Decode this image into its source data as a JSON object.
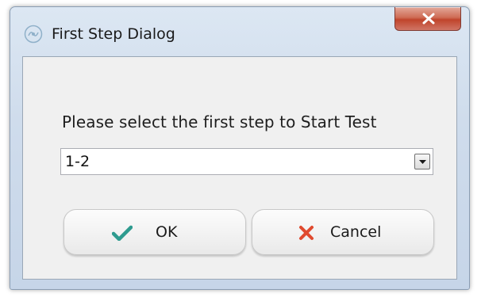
{
  "window": {
    "title": "First Step Dialog",
    "app_icon": "app-logo-icon",
    "close_icon": "close-icon"
  },
  "dialog": {
    "prompt": "Please select the first step to Start Test",
    "step_select": {
      "value": "1-2",
      "arrow_icon": "chevron-down-icon"
    },
    "ok_button": {
      "label": "OK",
      "icon": "checkmark-icon",
      "icon_color": "#2e9b8f"
    },
    "cancel_button": {
      "label": "Cancel",
      "icon": "x-icon",
      "icon_color": "#e04a2f"
    }
  }
}
